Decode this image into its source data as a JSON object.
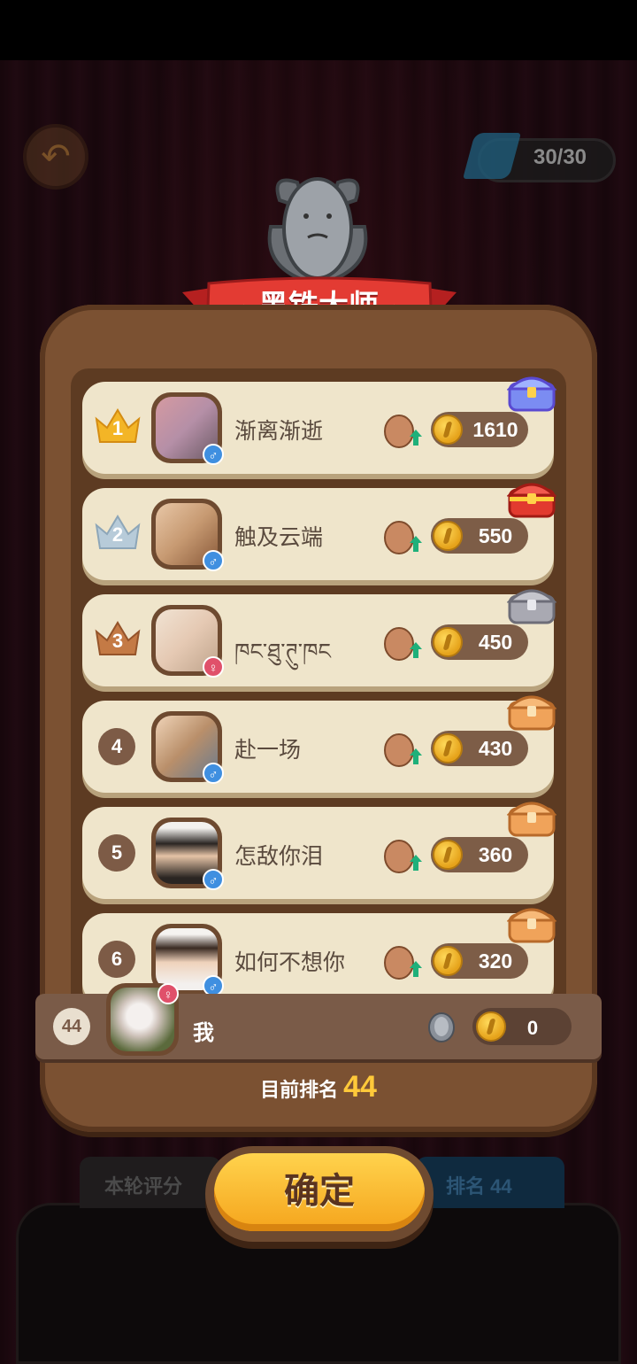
{
  "energy": {
    "text": "30/30",
    "icon": "energy-icon"
  },
  "banner": {
    "title": "黑铁大师"
  },
  "leaderboard": [
    {
      "rank": "1",
      "crown": "gold",
      "name": "渐离渐逝",
      "gender": "♂",
      "score": "1610",
      "chest": "blue-chest"
    },
    {
      "rank": "2",
      "crown": "silver",
      "name": "触及云端",
      "gender": "♂",
      "score": "550",
      "chest": "red-chest"
    },
    {
      "rank": "3",
      "crown": "bronze",
      "name": "ཁང་ཐུ་ཊུ་ཁང",
      "gender": "♀",
      "score": "450",
      "chest": "gray-chest"
    },
    {
      "rank": "4",
      "crown": "",
      "name": "赴一场",
      "gender": "♂",
      "score": "430",
      "chest": "wood-chest"
    },
    {
      "rank": "5",
      "crown": "",
      "name": "怎敌你泪",
      "gender": "♂",
      "score": "360",
      "chest": "wood-chest"
    },
    {
      "rank": "6",
      "crown": "",
      "name": "如何不想你",
      "gender": "♂",
      "score": "320",
      "chest": "wood-chest"
    }
  ],
  "me": {
    "rank": "44",
    "name": "我",
    "gender": "♀",
    "score": "0"
  },
  "current_rank": {
    "label": "目前排名",
    "value": "44"
  },
  "tabs": {
    "left": "本轮评分",
    "right": "排名 44"
  },
  "confirm": {
    "label": "确定"
  },
  "colors": {
    "gold": "#f3b526",
    "silver": "#b7cbd9",
    "bronze": "#c47a45",
    "accent": "#ffc93a"
  }
}
